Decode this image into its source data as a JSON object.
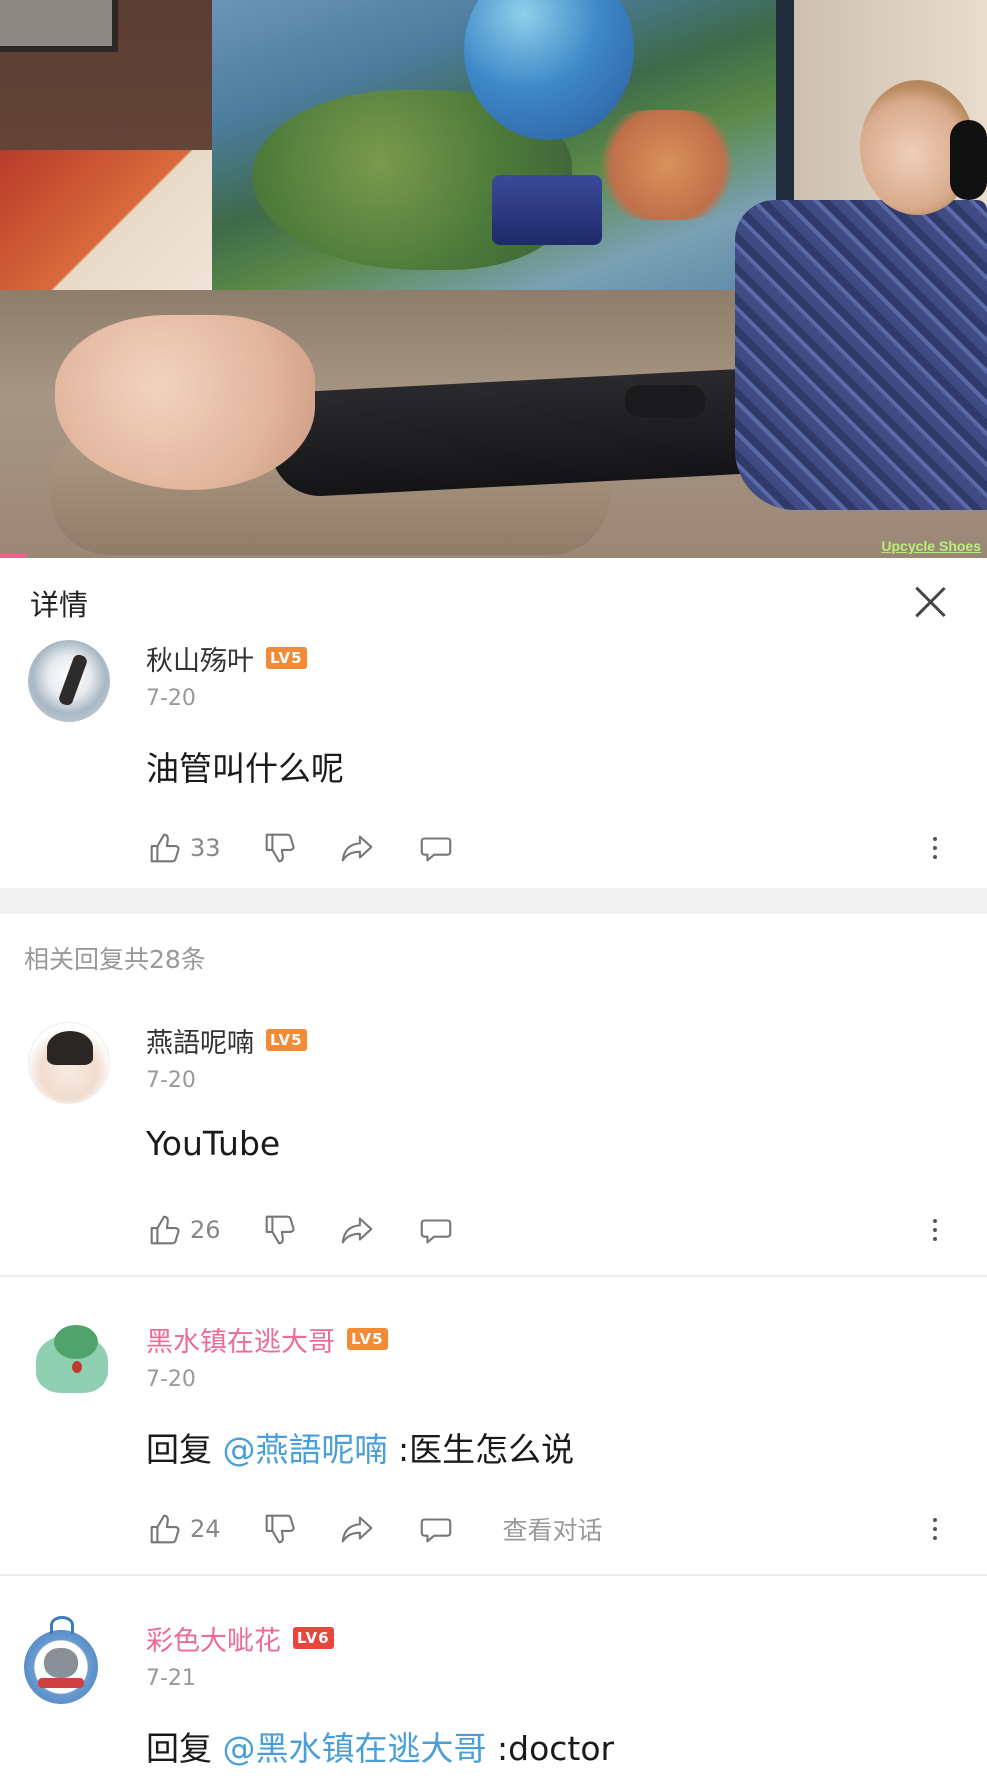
{
  "video": {
    "watermark": "Upcycle Shoes",
    "progress_fraction": 0.026
  },
  "panel": {
    "title": "详情",
    "close_icon": "close-icon"
  },
  "main_comment": {
    "username": "秋山殇叶",
    "level": "LV5",
    "date": "7-20",
    "text": "油管叫什么呢",
    "likes": "33"
  },
  "related_header": "相关回复共28条",
  "replies": [
    {
      "username": "燕語呢喃",
      "level": "LV5",
      "date": "7-20",
      "text": "YouTube",
      "likes": "26"
    },
    {
      "username": "黑水镇在逃大哥",
      "level": "LV5",
      "date": "7-20",
      "prefix": "回复",
      "mention": "@燕語呢喃",
      "text": ":医生怎么说",
      "likes": "24",
      "view_conversation": "查看对话"
    },
    {
      "username": "彩色大呲花",
      "level": "LV6",
      "date": "7-21",
      "prefix": "回复",
      "mention": "@黑水镇在逃大哥",
      "text": ":doctor"
    }
  ],
  "colors": {
    "accent_pink": "#ee6a98",
    "level_orange": "#f28a36",
    "level_red": "#e8463a",
    "mention_blue": "#4a9fd8"
  }
}
